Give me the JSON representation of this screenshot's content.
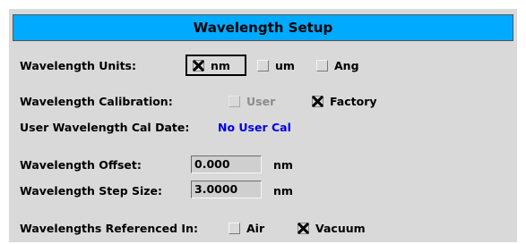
{
  "title": "Wavelength Setup",
  "units": {
    "label": "Wavelength Units:",
    "options": [
      {
        "label": "nm",
        "checked": true
      },
      {
        "label": "um",
        "checked": false
      },
      {
        "label": "Ang",
        "checked": false
      }
    ]
  },
  "calibration": {
    "label": "Wavelength Calibration:",
    "user_label": "User",
    "factory_label": "Factory"
  },
  "cal_date": {
    "label": "User Wavelength Cal Date:",
    "value": "No User Cal"
  },
  "offset": {
    "label": "Wavelength Offset:",
    "value": "0.000",
    "unit": "nm"
  },
  "step": {
    "label": "Wavelength Step Size:",
    "value": "3.0000",
    "unit": "nm"
  },
  "reference": {
    "label": "Wavelengths Referenced In:",
    "air_label": "Air",
    "vacuum_label": "Vacuum"
  },
  "colors": {
    "title_bar": "#00aaff",
    "panel": "#d9d9d9",
    "cal_value": "#0000ee"
  }
}
